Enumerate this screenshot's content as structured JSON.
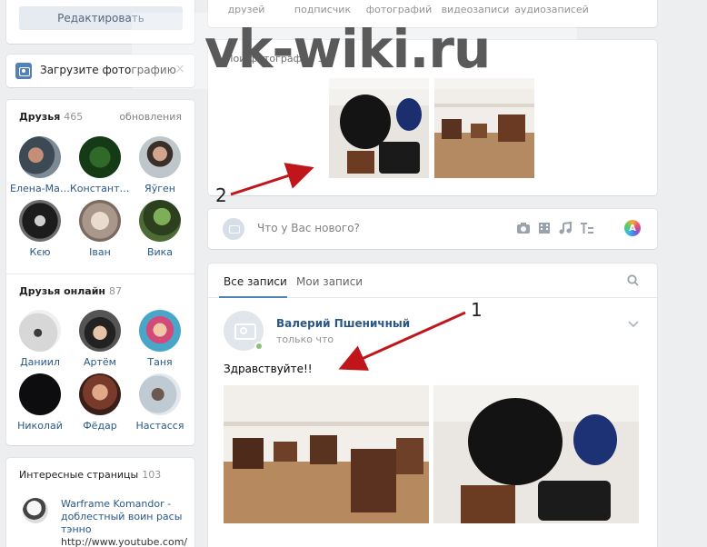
{
  "left": {
    "edit_label": "Редактировать",
    "upload_label": "Загрузите фотографию",
    "upload_close": "×",
    "friends": {
      "title": "Друзья",
      "count": "465",
      "updates": "обновления",
      "items": [
        {
          "name": "Елена-Мар..."
        },
        {
          "name": "Константин"
        },
        {
          "name": "Яўген"
        },
        {
          "name": "Кєю"
        },
        {
          "name": "Іван"
        },
        {
          "name": "Вика"
        }
      ]
    },
    "online": {
      "title": "Друзья онлайн",
      "count": "87",
      "items": [
        {
          "name": "Даниил"
        },
        {
          "name": "Артём"
        },
        {
          "name": "Таня"
        },
        {
          "name": "Николай"
        },
        {
          "name": "Фёдар"
        },
        {
          "name": "Настасся"
        }
      ]
    },
    "pages": {
      "title": "Интересные страницы",
      "count": "103",
      "item_name": "Warframe Komandor - доблестный воин расы тэнно",
      "item_url": "http://www.youtube.com/"
    }
  },
  "right": {
    "counters": [
      "друзей",
      "подписчик",
      "фотографий",
      "видеозаписи",
      "аудиозаписей"
    ],
    "photos_title": "Мои фотографии 3",
    "composer_placeholder": "Что у Вас нового?",
    "composer_ai": "A",
    "tabs": {
      "all": "Все записи",
      "mine": "Мои записи"
    },
    "post": {
      "author": "Валерий Пшеничный",
      "time": "только что",
      "text": "Здравствуйте!!"
    }
  },
  "overlay": {
    "watermark": "vk-wiki.ru",
    "marker_1": "1",
    "marker_2": "2"
  },
  "colors": {
    "link": "#2a5885",
    "accent": "#5181b8",
    "arrow": "#c0161b",
    "online": "#8ac176"
  }
}
